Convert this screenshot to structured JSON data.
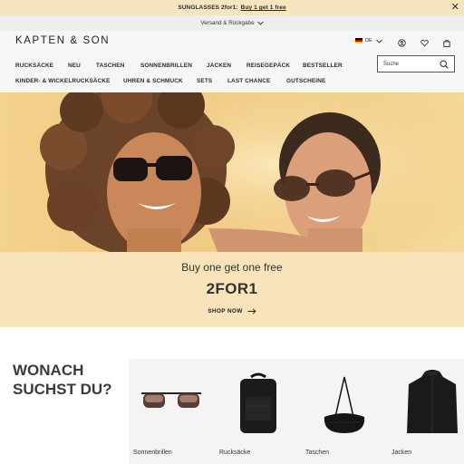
{
  "promo": {
    "text": "SUNGLASSES 2for1:",
    "link": "Buy 1 get 1 free",
    "close_glyph": "✕"
  },
  "shipping": {
    "text": "Versand & Rückgabe"
  },
  "header": {
    "logo": "KAPTEN & SON",
    "language": "DE",
    "search_placeholder": "Suche"
  },
  "nav": {
    "row1": [
      "RUCKSÄCKE",
      "NEU",
      "TASCHEN",
      "SONNENBRILLEN",
      "JACKEN",
      "REISEGEPÄCK",
      "BESTSELLER"
    ],
    "row2": [
      "KINDER- & WICKELRUCKSÄCKE",
      "UHREN & SCHMUCK",
      "SETS",
      "LAST CHANCE",
      "GUTSCHEINE"
    ]
  },
  "hero": {
    "tagline": "Buy one get one free",
    "code": "2FOR1",
    "cta": "SHOP NOW"
  },
  "categories": {
    "title_line1": "WONACH",
    "title_line2": "SUCHST DU?",
    "items": [
      "Sonnenbrillen",
      "Rucksäcke",
      "Taschen",
      "Jacken"
    ]
  },
  "colors": {
    "promo_bg": "#f6e6bf",
    "hero_bg": "#f2cf8c",
    "band_bg": "#f8e3ba",
    "header_bg": "#f6f6f6"
  },
  "icons": [
    "close-icon",
    "chevron-down-icon",
    "account-icon",
    "heart-icon",
    "bag-icon",
    "search-icon",
    "arrow-right-icon"
  ]
}
